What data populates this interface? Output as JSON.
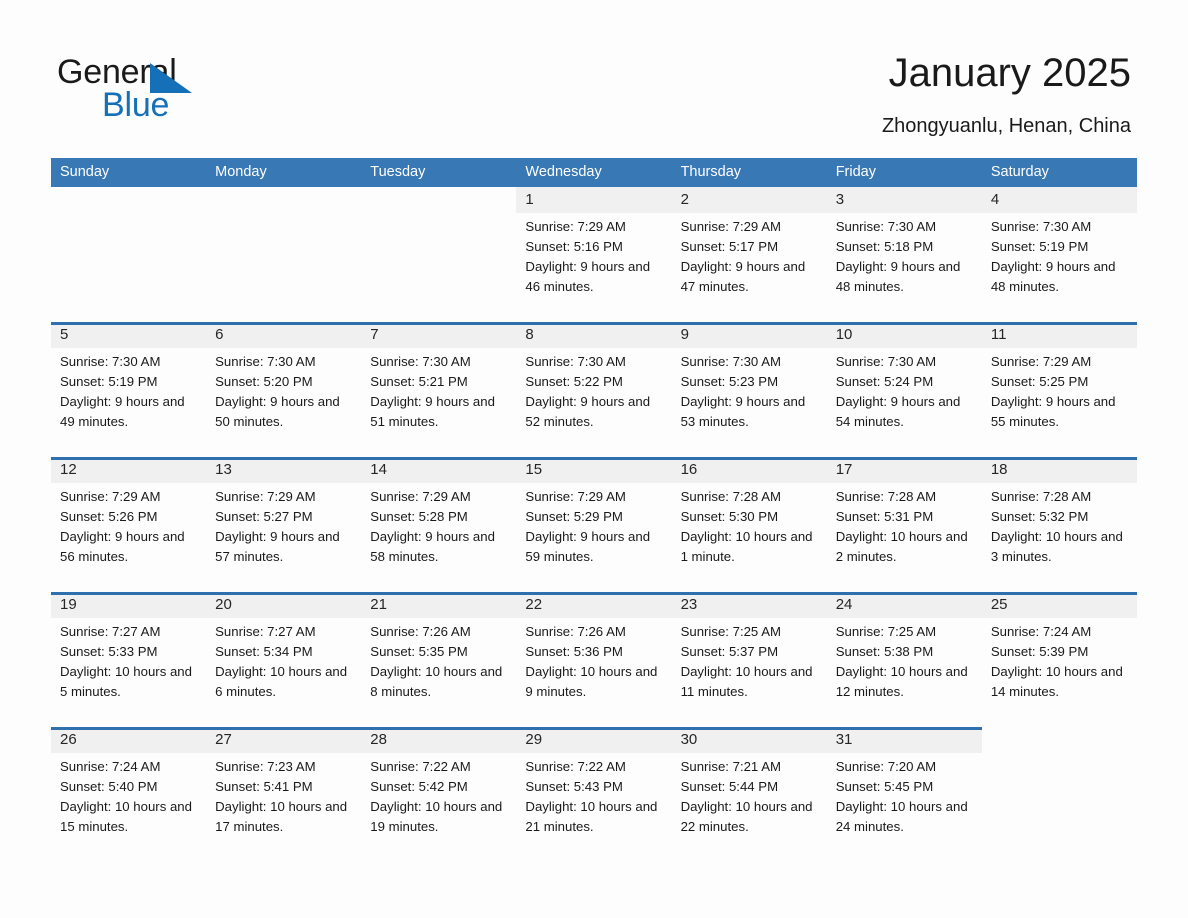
{
  "logo": {
    "word_one": "General",
    "word_two": "Blue",
    "accent_color": "#1670b8",
    "triangle_icon": "triangle-icon"
  },
  "header": {
    "title": "January 2025",
    "location": "Zhongyuanlu, Henan, China"
  },
  "calendar": {
    "header_bg": "#3878b4",
    "daynum_bg": "#f0f0f0",
    "rule_color": "#2f6fae",
    "weekdays": [
      "Sunday",
      "Monday",
      "Tuesday",
      "Wednesday",
      "Thursday",
      "Friday",
      "Saturday"
    ],
    "weeks": [
      [
        {
          "day": "",
          "sunrise": "",
          "sunset": "",
          "daylight": "",
          "blank": true
        },
        {
          "day": "",
          "sunrise": "",
          "sunset": "",
          "daylight": "",
          "blank": true
        },
        {
          "day": "",
          "sunrise": "",
          "sunset": "",
          "daylight": "",
          "blank": true
        },
        {
          "day": "1",
          "sunrise": "Sunrise: 7:29 AM",
          "sunset": "Sunset: 5:16 PM",
          "daylight": "Daylight: 9 hours and 46 minutes."
        },
        {
          "day": "2",
          "sunrise": "Sunrise: 7:29 AM",
          "sunset": "Sunset: 5:17 PM",
          "daylight": "Daylight: 9 hours and 47 minutes."
        },
        {
          "day": "3",
          "sunrise": "Sunrise: 7:30 AM",
          "sunset": "Sunset: 5:18 PM",
          "daylight": "Daylight: 9 hours and 48 minutes."
        },
        {
          "day": "4",
          "sunrise": "Sunrise: 7:30 AM",
          "sunset": "Sunset: 5:19 PM",
          "daylight": "Daylight: 9 hours and 48 minutes."
        }
      ],
      [
        {
          "day": "5",
          "sunrise": "Sunrise: 7:30 AM",
          "sunset": "Sunset: 5:19 PM",
          "daylight": "Daylight: 9 hours and 49 minutes."
        },
        {
          "day": "6",
          "sunrise": "Sunrise: 7:30 AM",
          "sunset": "Sunset: 5:20 PM",
          "daylight": "Daylight: 9 hours and 50 minutes."
        },
        {
          "day": "7",
          "sunrise": "Sunrise: 7:30 AM",
          "sunset": "Sunset: 5:21 PM",
          "daylight": "Daylight: 9 hours and 51 minutes."
        },
        {
          "day": "8",
          "sunrise": "Sunrise: 7:30 AM",
          "sunset": "Sunset: 5:22 PM",
          "daylight": "Daylight: 9 hours and 52 minutes."
        },
        {
          "day": "9",
          "sunrise": "Sunrise: 7:30 AM",
          "sunset": "Sunset: 5:23 PM",
          "daylight": "Daylight: 9 hours and 53 minutes."
        },
        {
          "day": "10",
          "sunrise": "Sunrise: 7:30 AM",
          "sunset": "Sunset: 5:24 PM",
          "daylight": "Daylight: 9 hours and 54 minutes."
        },
        {
          "day": "11",
          "sunrise": "Sunrise: 7:29 AM",
          "sunset": "Sunset: 5:25 PM",
          "daylight": "Daylight: 9 hours and 55 minutes."
        }
      ],
      [
        {
          "day": "12",
          "sunrise": "Sunrise: 7:29 AM",
          "sunset": "Sunset: 5:26 PM",
          "daylight": "Daylight: 9 hours and 56 minutes."
        },
        {
          "day": "13",
          "sunrise": "Sunrise: 7:29 AM",
          "sunset": "Sunset: 5:27 PM",
          "daylight": "Daylight: 9 hours and 57 minutes."
        },
        {
          "day": "14",
          "sunrise": "Sunrise: 7:29 AM",
          "sunset": "Sunset: 5:28 PM",
          "daylight": "Daylight: 9 hours and 58 minutes."
        },
        {
          "day": "15",
          "sunrise": "Sunrise: 7:29 AM",
          "sunset": "Sunset: 5:29 PM",
          "daylight": "Daylight: 9 hours and 59 minutes."
        },
        {
          "day": "16",
          "sunrise": "Sunrise: 7:28 AM",
          "sunset": "Sunset: 5:30 PM",
          "daylight": "Daylight: 10 hours and 1 minute."
        },
        {
          "day": "17",
          "sunrise": "Sunrise: 7:28 AM",
          "sunset": "Sunset: 5:31 PM",
          "daylight": "Daylight: 10 hours and 2 minutes."
        },
        {
          "day": "18",
          "sunrise": "Sunrise: 7:28 AM",
          "sunset": "Sunset: 5:32 PM",
          "daylight": "Daylight: 10 hours and 3 minutes."
        }
      ],
      [
        {
          "day": "19",
          "sunrise": "Sunrise: 7:27 AM",
          "sunset": "Sunset: 5:33 PM",
          "daylight": "Daylight: 10 hours and 5 minutes."
        },
        {
          "day": "20",
          "sunrise": "Sunrise: 7:27 AM",
          "sunset": "Sunset: 5:34 PM",
          "daylight": "Daylight: 10 hours and 6 minutes."
        },
        {
          "day": "21",
          "sunrise": "Sunrise: 7:26 AM",
          "sunset": "Sunset: 5:35 PM",
          "daylight": "Daylight: 10 hours and 8 minutes."
        },
        {
          "day": "22",
          "sunrise": "Sunrise: 7:26 AM",
          "sunset": "Sunset: 5:36 PM",
          "daylight": "Daylight: 10 hours and 9 minutes."
        },
        {
          "day": "23",
          "sunrise": "Sunrise: 7:25 AM",
          "sunset": "Sunset: 5:37 PM",
          "daylight": "Daylight: 10 hours and 11 minutes."
        },
        {
          "day": "24",
          "sunrise": "Sunrise: 7:25 AM",
          "sunset": "Sunset: 5:38 PM",
          "daylight": "Daylight: 10 hours and 12 minutes."
        },
        {
          "day": "25",
          "sunrise": "Sunrise: 7:24 AM",
          "sunset": "Sunset: 5:39 PM",
          "daylight": "Daylight: 10 hours and 14 minutes."
        }
      ],
      [
        {
          "day": "26",
          "sunrise": "Sunrise: 7:24 AM",
          "sunset": "Sunset: 5:40 PM",
          "daylight": "Daylight: 10 hours and 15 minutes."
        },
        {
          "day": "27",
          "sunrise": "Sunrise: 7:23 AM",
          "sunset": "Sunset: 5:41 PM",
          "daylight": "Daylight: 10 hours and 17 minutes."
        },
        {
          "day": "28",
          "sunrise": "Sunrise: 7:22 AM",
          "sunset": "Sunset: 5:42 PM",
          "daylight": "Daylight: 10 hours and 19 minutes."
        },
        {
          "day": "29",
          "sunrise": "Sunrise: 7:22 AM",
          "sunset": "Sunset: 5:43 PM",
          "daylight": "Daylight: 10 hours and 21 minutes."
        },
        {
          "day": "30",
          "sunrise": "Sunrise: 7:21 AM",
          "sunset": "Sunset: 5:44 PM",
          "daylight": "Daylight: 10 hours and 22 minutes."
        },
        {
          "day": "31",
          "sunrise": "Sunrise: 7:20 AM",
          "sunset": "Sunset: 5:45 PM",
          "daylight": "Daylight: 10 hours and 24 minutes."
        },
        {
          "day": "",
          "sunrise": "",
          "sunset": "",
          "daylight": "",
          "empty_trailing": true
        }
      ]
    ]
  }
}
